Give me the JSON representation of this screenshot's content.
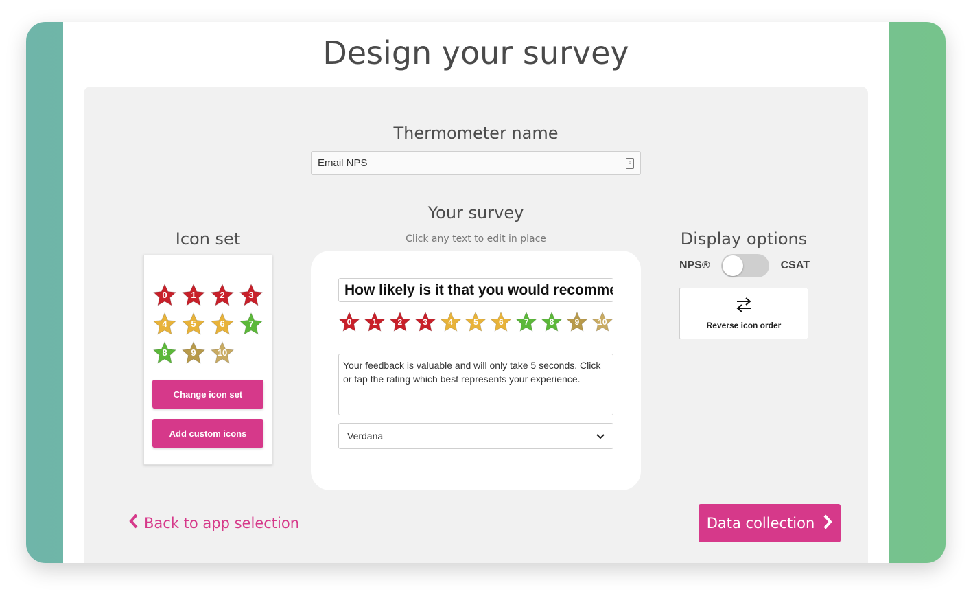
{
  "page": {
    "title": "Design your survey"
  },
  "thermometer": {
    "label": "Thermometer name",
    "value": "Email NPS"
  },
  "survey": {
    "label": "Your survey",
    "hint": "Click any text to edit in place",
    "question": "How likely is it that you would recommend",
    "feedback": "Your feedback is valuable and will only take 5 seconds. Click or tap the rating which best represents your experience.",
    "font_select": "Verdana"
  },
  "icon_set": {
    "label": "Icon set",
    "change_label": "Change icon set",
    "custom_label": "Add custom icons"
  },
  "display_options": {
    "label": "Display options",
    "left_label": "NPS®",
    "right_label": "CSAT",
    "reverse_label": "Reverse icon order"
  },
  "nav": {
    "back_label": "Back to app selection",
    "next_label": "Data collection"
  },
  "stars": [
    {
      "n": "0",
      "color": "#c8202a"
    },
    {
      "n": "1",
      "color": "#c8202a"
    },
    {
      "n": "2",
      "color": "#c8202a"
    },
    {
      "n": "3",
      "color": "#c8202a"
    },
    {
      "n": "4",
      "color": "#e8b33a"
    },
    {
      "n": "5",
      "color": "#e8b33a"
    },
    {
      "n": "6",
      "color": "#e8b33a"
    },
    {
      "n": "7",
      "color": "#5cb83a"
    },
    {
      "n": "8",
      "color": "#5cb83a"
    },
    {
      "n": "9",
      "color": "#b89a4a"
    },
    {
      "n": "10",
      "color": "#c9ab62"
    }
  ],
  "colors": {
    "accent": "#d6398a"
  }
}
